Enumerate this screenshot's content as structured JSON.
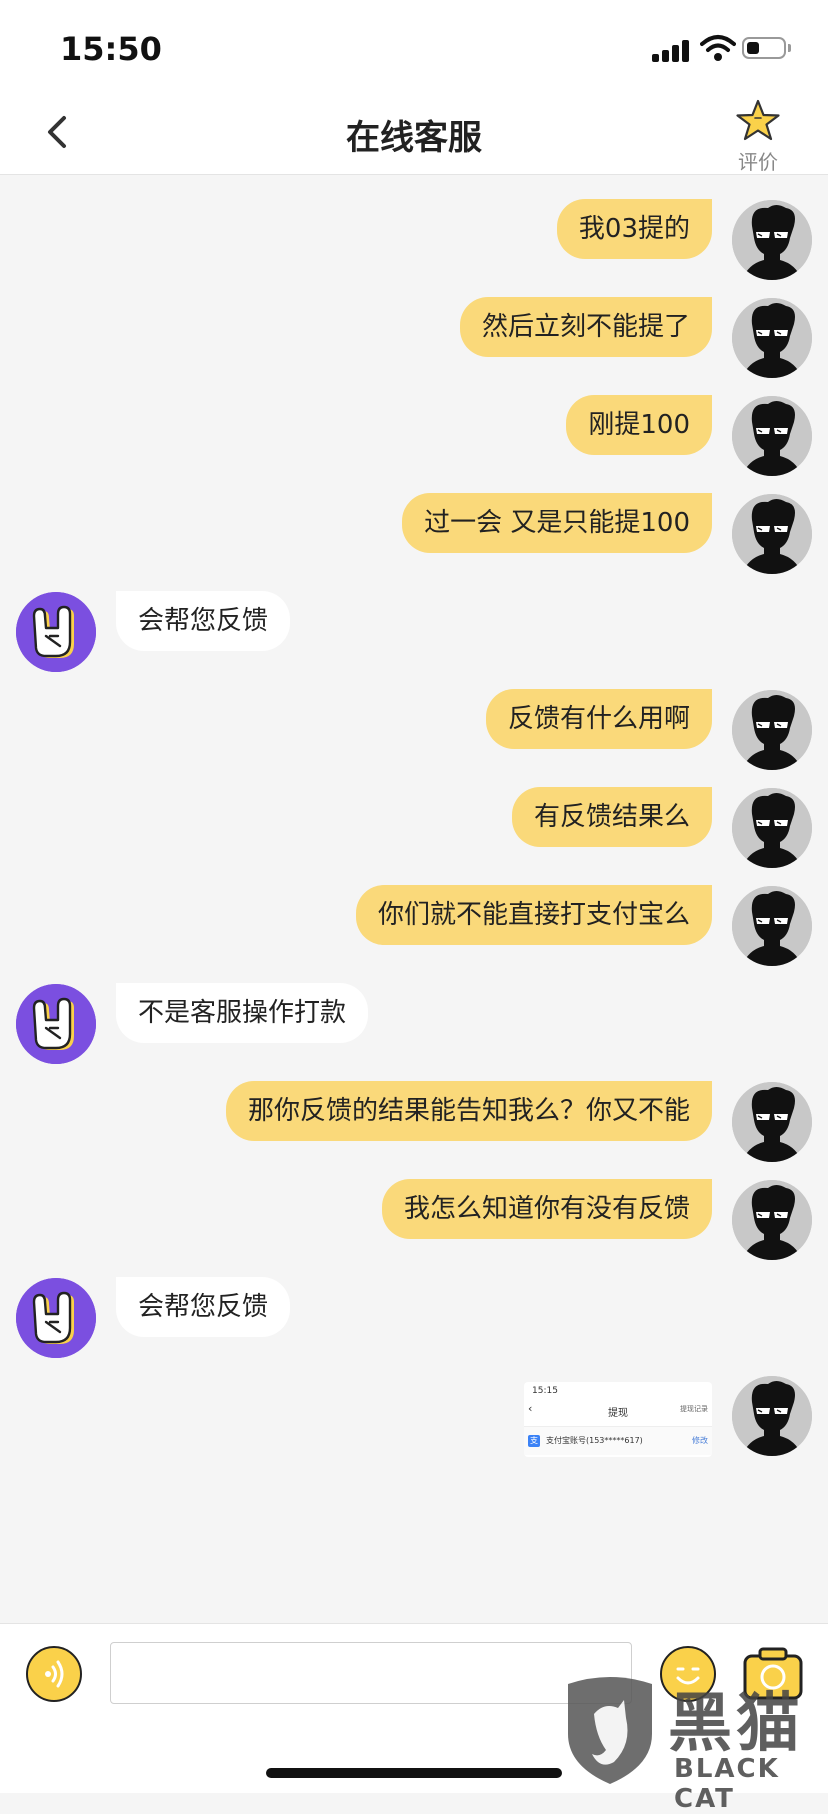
{
  "status_bar": {
    "time": "15:50"
  },
  "nav": {
    "title": "在线客服",
    "rate_label": "评价"
  },
  "messages": [
    {
      "from": "user",
      "text": "我03提的"
    },
    {
      "from": "user",
      "text": "然后立刻不能提了"
    },
    {
      "from": "user",
      "text": "刚提100"
    },
    {
      "from": "user",
      "text": "过一会 又是只能提100"
    },
    {
      "from": "service",
      "text": "会帮您反馈"
    },
    {
      "from": "user",
      "text": "反馈有什么用啊"
    },
    {
      "from": "user",
      "text": "有反馈结果么"
    },
    {
      "from": "user",
      "text": "你们就不能直接打支付宝么"
    },
    {
      "from": "service",
      "text": "不是客服操作打款"
    },
    {
      "from": "user",
      "text": "那你反馈的结果能告知我么？你又不能"
    },
    {
      "from": "user",
      "text": "我怎么知道你有没有反馈"
    },
    {
      "from": "service",
      "text": "会帮您反馈"
    }
  ],
  "image_message": {
    "from": "user",
    "time": "15:15",
    "title": "提现",
    "link": "提现记录",
    "account": "支付宝账号(153*****617)",
    "action": "修改",
    "alipay_mark": "支"
  },
  "input": {
    "value": "",
    "placeholder": ""
  },
  "watermark": {
    "cn": "黑猫",
    "en": "BLACK CAT"
  },
  "colors": {
    "user_bubble": "#fad97a",
    "service_avatar": "#7b4fe0",
    "accent": "#fad14a"
  },
  "icons": [
    "back-arrow-icon",
    "star-icon",
    "voice-icon",
    "emoji-icon",
    "camera-icon"
  ]
}
